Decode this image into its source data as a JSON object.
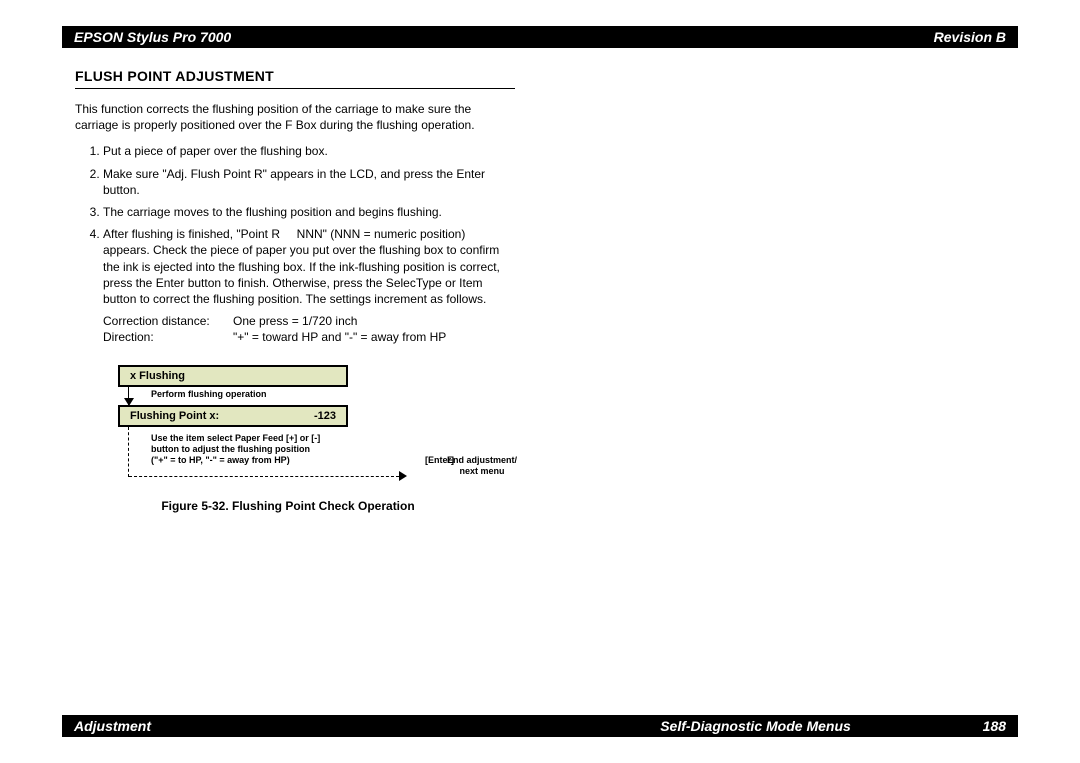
{
  "header": {
    "left": "EPSON Stylus Pro 7000",
    "right": "Revision B"
  },
  "footer": {
    "left": "Adjustment",
    "center": "Self-Diagnostic Mode Menus",
    "right": "188"
  },
  "section": {
    "title": "FLUSH POINT ADJUSTMENT",
    "intro": "This function corrects the flushing position of the carriage to make sure the carriage is properly positioned over the F Box during the flushing operation.",
    "steps": [
      "Put a piece of paper over the flushing box.",
      "Make sure \"Adj. Flush Point R\" appears in the LCD, and press the Enter button.",
      "The carriage moves to the flushing position and begins flushing.",
      "After flushing is finished, \"Point R     NNN\" (NNN = numeric position) appears. Check the piece of paper you put over the flushing box to confirm the ink is ejected into the flushing box. If the ink-flushing position is correct, press the Enter button to finish. Otherwise, press the SelecType or Item button to correct the flushing position. The settings increment as follows."
    ],
    "correction_label": "Correction distance:",
    "correction_value": "One press = 1/720 inch",
    "direction_label": "Direction:",
    "direction_value": "\"+\" = toward HP and \"-\" = away from HP"
  },
  "diagram": {
    "box1": "x Flushing",
    "note1": "Perform flushing operation",
    "box2_left": "Flushing Point x:",
    "box2_right": "-123",
    "note2_line1": "Use the item select Paper Feed [+] or [-]",
    "note2_line2": "button to adjust the flushing position",
    "note2_line3": "(\"+\" = to HP, \"-\" = away from HP)",
    "enter": "[Enter]",
    "end": "End adjustment/ next menu",
    "caption": "Figure 5-32.  Flushing Point Check Operation"
  }
}
